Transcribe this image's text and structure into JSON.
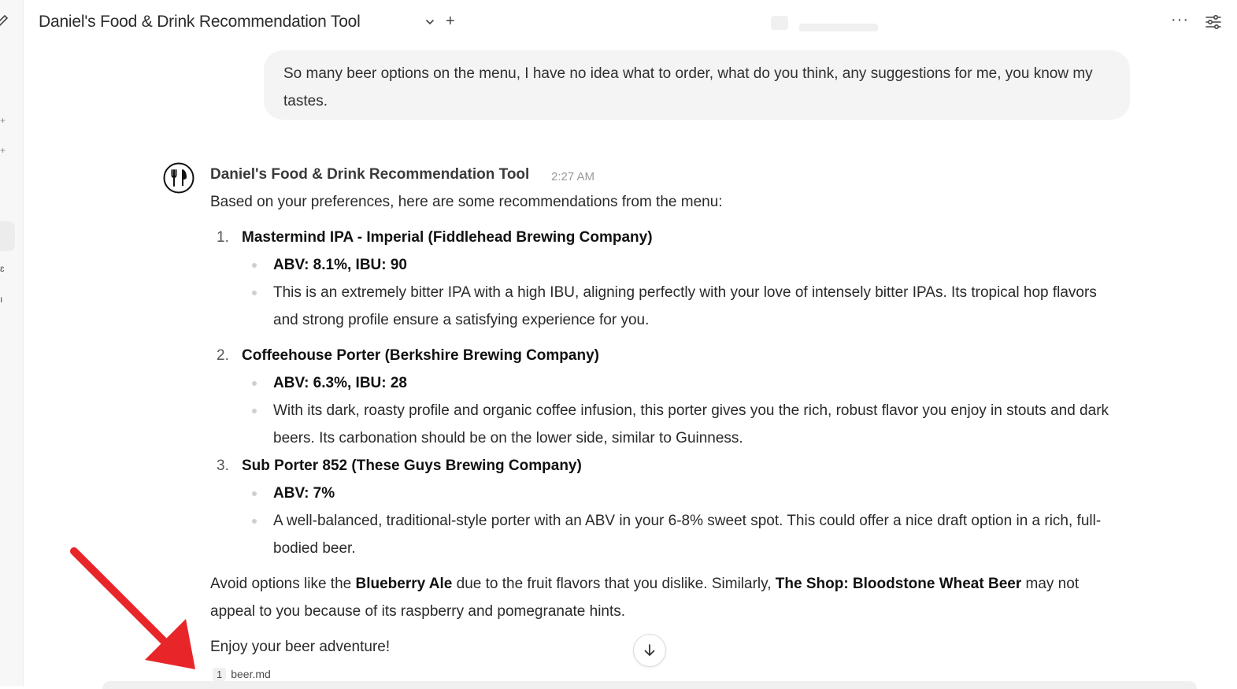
{
  "header": {
    "title": "Daniel's Food & Drink Recommendation Tool",
    "more_label": "···"
  },
  "user_message": {
    "text": "So many beer options on the menu, I have no idea what to order, what do you think, any suggestions for me, you know my tastes."
  },
  "assistant": {
    "name": "Daniel's Food & Drink Recommendation Tool",
    "time": "2:27 AM",
    "intro": "Based on your preferences, here are some recommendations from the menu:",
    "recommendations": [
      {
        "num": "1.",
        "title": "Mastermind IPA - Imperial (Fiddlehead Brewing Company)",
        "stats": "ABV: 8.1%, IBU: 90",
        "desc": "This is an extremely bitter IPA with a high IBU, aligning perfectly with your love of intensely bitter IPAs. Its tropical hop flavors and strong profile ensure a satisfying experience for you."
      },
      {
        "num": "2.",
        "title": "Coffeehouse Porter (Berkshire Brewing Company)",
        "stats": "ABV: 6.3%, IBU: 28",
        "desc": "With its dark, roasty profile and organic coffee infusion, this porter gives you the rich, robust flavor you enjoy in stouts and dark beers. Its carbonation should be on the lower side, similar to Guinness."
      },
      {
        "num": "3.",
        "title": "Sub Porter 852 (These Guys Brewing Company)",
        "stats": "ABV: 7%",
        "desc": "A well-balanced, traditional-style porter with an ABV in your 6-8% sweet spot. This could offer a nice draft option in a rich, full-bodied beer."
      }
    ],
    "avoid": {
      "pre": "Avoid options like the ",
      "item1": "Blueberry Ale",
      "mid": " due to the fruit flavors that you dislike. Similarly, ",
      "item2": "The Shop: Bloodstone Wheat Beer",
      "post": " may not appeal to you because of its raspberry and pomegranate hints."
    },
    "closing": "Enjoy your beer adventure!",
    "citation": {
      "num": "1",
      "file": "beer.md"
    }
  },
  "colors": {
    "annotation_arrow": "#e8262a",
    "bubble_bg": "#f4f4f5"
  },
  "icons": [
    "edit-icon",
    "chevron-down-icon",
    "plus-icon",
    "more-icon",
    "settings-sliders-icon",
    "fork-knife-icon",
    "arrow-down-icon"
  ]
}
